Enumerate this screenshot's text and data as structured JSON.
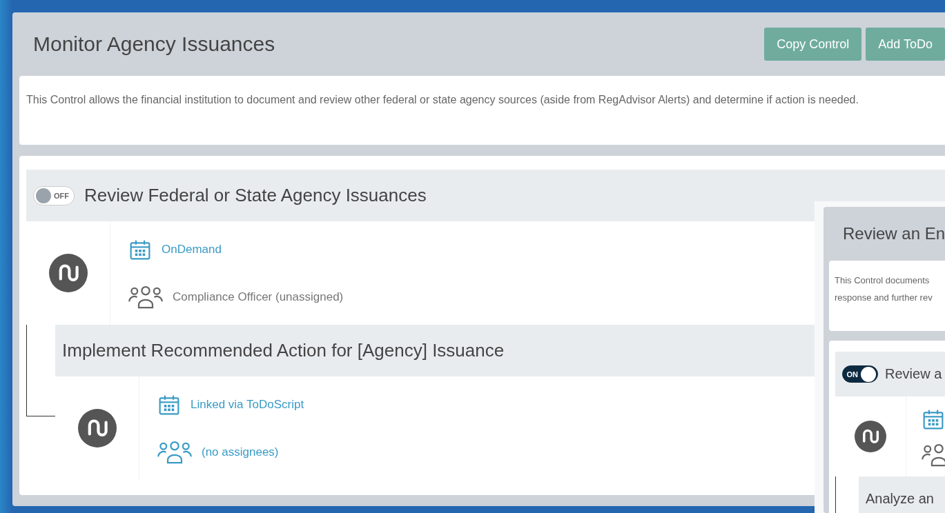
{
  "main_control": {
    "title": "Monitor Agency Issuances",
    "buttons": [
      "Copy Control",
      "Add ToDo"
    ],
    "description": "This Control allows the financial institution to document and review other federal or state agency sources (aside from RegAdvisor Alerts) and determine if action is needed.",
    "todos": [
      {
        "title": "Review Federal or State Agency Issuances",
        "toggle_label": "OFF",
        "on": false,
        "schedule": "OnDemand",
        "assignee": {
          "kind": "role",
          "text": "Compliance Officer (unassigned)"
        },
        "children": [
          {
            "title": "Implement Recommended Action for [Agency] Issuance",
            "schedule": "Linked via ToDoScript",
            "assignee": {
              "kind": "none",
              "text": "(no assignees)"
            }
          }
        ]
      }
    ]
  },
  "overlay_control": {
    "title": "Review an En",
    "description_lines": [
      "This Control documents",
      "response and further rev"
    ],
    "todos": [
      {
        "title": "Review a",
        "toggle_label": "ON",
        "on": true,
        "assignee": {
          "kind": "role"
        },
        "children": [
          {
            "title": "Analyze an"
          }
        ]
      }
    ]
  }
}
